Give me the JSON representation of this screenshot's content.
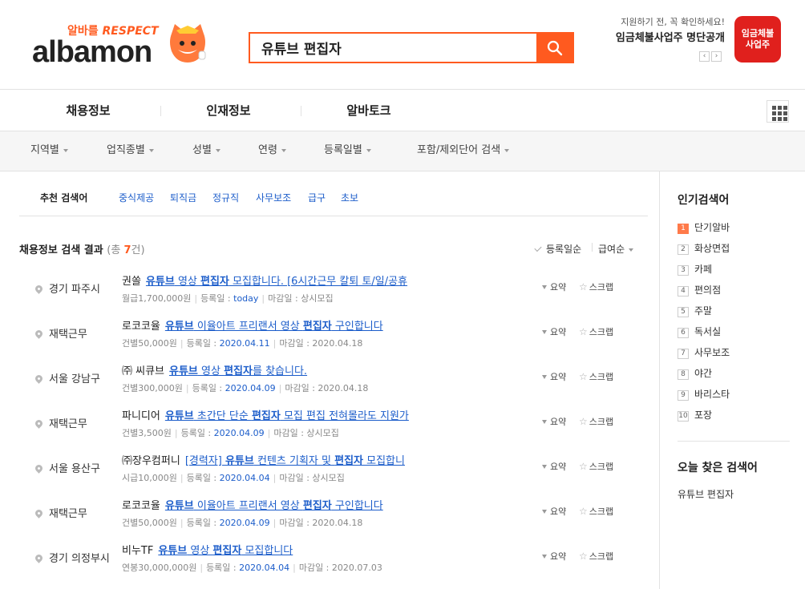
{
  "logo": {
    "tag_1": "알바를",
    "tag_2": "RESPECT",
    "word": "albamon"
  },
  "search": {
    "value": "유튜브 편집자",
    "icon": "search-icon"
  },
  "banner": {
    "small": "지원하기 전, 꼭 확인하세요!",
    "big": "임금체불사업주 명단공개",
    "badge_1": "임금체불",
    "badge_2": "사업주",
    "prev": "‹",
    "next": "›"
  },
  "nav": {
    "items": [
      "채용정보",
      "인재정보",
      "알바토크"
    ]
  },
  "filters": [
    "지역별",
    "업직종별",
    "성별",
    "연령",
    "등록일별",
    "포함/제외단어 검색"
  ],
  "recommend": {
    "title": "추천 검색어",
    "keywords": [
      "중식제공",
      "퇴직금",
      "정규직",
      "사무보조",
      "급구",
      "초보"
    ]
  },
  "results": {
    "title": "채용정보 검색 결과",
    "count_prefix": "(총 ",
    "count": "7",
    "count_suffix": "건)",
    "sort_registered": "등록일순",
    "sort_pay": "급여순"
  },
  "action_labels": {
    "summary": "요약",
    "scrap": "스크랩",
    "reg": "등록일 :",
    "due": "마감일 :"
  },
  "jobs": [
    {
      "loc": "경기 파주시",
      "company": "권쏠",
      "t1": "유튜브",
      "t2": " 영상 ",
      "t3": "편집자",
      "t4": " 모집합니다. [6시간근무 칼퇴 토/일/공휴",
      "pay": "월급1,700,000원",
      "reg": "today",
      "due": "상시모집"
    },
    {
      "loc": "재택근무",
      "company": "로코코율",
      "t1": "유튜브",
      "t2": " 이율아트 프리랜서 영상 ",
      "t3": "편집자",
      "t4": " 구인합니다",
      "pay": "건별50,000원",
      "reg": "2020.04.11",
      "due": "2020.04.18"
    },
    {
      "loc": "서울 강남구",
      "company": "㈜ 씨큐브",
      "t1": "유튜브",
      "t2": " 영상 ",
      "t3": "편집자",
      "t4": "를 찾습니다.",
      "pay": "건별300,000원",
      "reg": "2020.04.09",
      "due": "2020.04.18"
    },
    {
      "loc": "재택근무",
      "company": "파니디어",
      "t1": "유튜브",
      "t2": " 초간단 단순 ",
      "t3": "편집자",
      "t4": " 모집 편집 전혀몰라도 지원가",
      "pay": "건별3,500원",
      "reg": "2020.04.09",
      "due": "상시모집"
    },
    {
      "loc": "서울 용산구",
      "company": "㈜장우컴퍼니",
      "t0": "[경력자] ",
      "t1": "유튜브",
      "t2": " 컨텐츠 기획자 및 ",
      "t3": "편집자",
      "t4": " 모집합니",
      "pay": "시급10,000원",
      "reg": "2020.04.04",
      "due": "상시모집"
    },
    {
      "loc": "재택근무",
      "company": "로코코율",
      "t1": "유튜브",
      "t2": " 이율아트 프리랜서 영상 ",
      "t3": "편집자",
      "t4": " 구인합니다",
      "pay": "건별50,000원",
      "reg": "2020.04.09",
      "due": "2020.04.18"
    },
    {
      "loc": "경기 의정부시",
      "company": "비누TF",
      "t1": "유튜브",
      "t2": " 영상 ",
      "t3": "편집자",
      "t4": " 모집합니다",
      "pay": "연봉30,000,000원",
      "reg": "2020.04.04",
      "due": "2020.07.03"
    }
  ],
  "sidebar": {
    "popular_title": "인기검색어",
    "popular": [
      "단기알바",
      "화상면접",
      "카페",
      "편의점",
      "주말",
      "독서실",
      "사무보조",
      "야간",
      "바리스타",
      "포장"
    ],
    "today_title": "오늘 찾은 검색어",
    "today": "유튜브 편집자"
  },
  "colors": {
    "accent": "#ff5a1f",
    "link": "#1c5dca",
    "badge": "#e0201d"
  }
}
